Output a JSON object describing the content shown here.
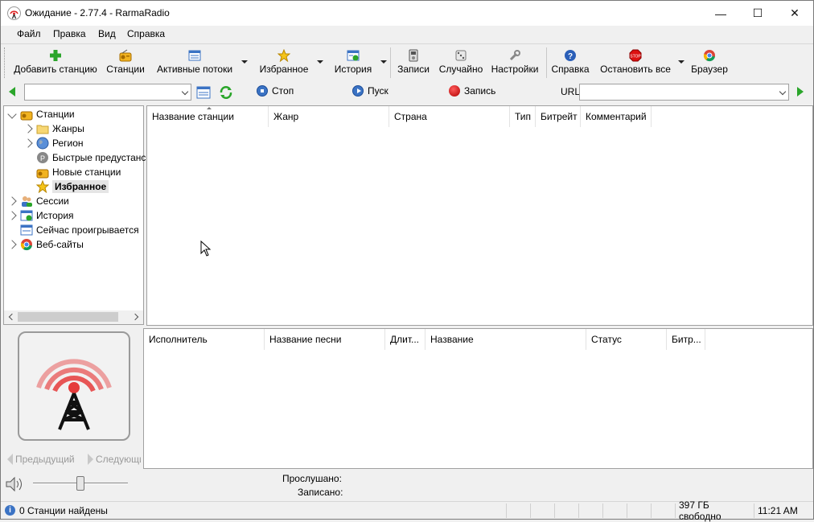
{
  "window": {
    "title": "Ожидание - 2.77.4 - RarmaRadio",
    "min_glyph": "—",
    "max_glyph": "☐",
    "close_glyph": "✕"
  },
  "menu": [
    "Файл",
    "Правка",
    "Вид",
    "Справка"
  ],
  "toolbar": {
    "add_station": "Добавить станцию",
    "stations": "Станции",
    "active_streams": "Активные потоки",
    "favorites": "Избранное",
    "history": "История",
    "records": "Записи",
    "random": "Случайно",
    "settings": "Настройки",
    "help": "Справка",
    "stop_all": "Остановить все",
    "browser": "Браузер"
  },
  "bar2": {
    "search_value": "",
    "stop": "Стоп",
    "play": "Пуск",
    "record": "Запись",
    "url_label": "URL",
    "url_value": ""
  },
  "tree": {
    "stations": "Станции",
    "genres": "Жанры",
    "region": "Регион",
    "presets": "Быстрые предустанс",
    "new_stations": "Новые станции",
    "favorites": "Избранное",
    "sessions": "Сессии",
    "history": "История",
    "now_playing": "Сейчас проигрывается",
    "websites": "Веб-сайты"
  },
  "stations_table": {
    "columns": [
      "Название станции",
      "Жанр",
      "Страна",
      "Тип",
      "Битрейт",
      "Комментарий"
    ]
  },
  "tracks_table": {
    "columns": [
      "Исполнитель",
      "Название песни",
      "Длит...",
      "Название",
      "Статус",
      "Битр..."
    ]
  },
  "player": {
    "prev": "Предыдущий",
    "next": "Следующий",
    "listened_label": "Прослушано:",
    "recorded_label": "Записано:",
    "volume_level": 0.5
  },
  "status": {
    "found": "0 Станции найдены",
    "free_space": "397 ГБ свободно",
    "time": "11:21 AM"
  },
  "colors": {
    "accent_blue": "#3b73c4",
    "record_red": "#cc1111",
    "go_green": "#2aa52a"
  }
}
